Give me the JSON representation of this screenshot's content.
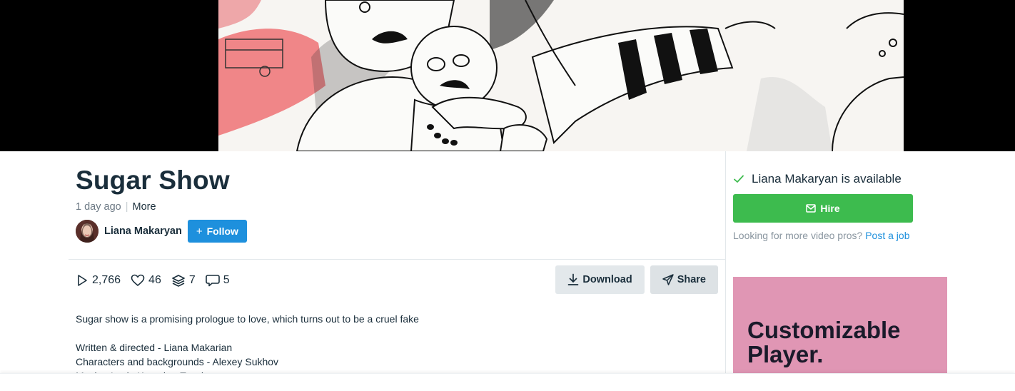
{
  "video": {
    "description_icon": "animation-still"
  },
  "clip": {
    "title": "Sugar Show",
    "age": "1 day ago",
    "more_label": "More"
  },
  "owner": {
    "name": "Liana Makaryan",
    "follow_label": "Follow"
  },
  "stats": {
    "plays": "2,766",
    "likes": "46",
    "collections": "7",
    "comments": "5"
  },
  "actions": {
    "download_label": "Download",
    "share_label": "Share"
  },
  "description": {
    "summary": "Sugar show is a promising prologue to love, which turns out to be a cruel fake",
    "credits": [
      "Written & directed - Liana Makarian",
      "Characters and backgrounds - Alexey Sukhov",
      "Music - Lusia Kazarian-Topchyan"
    ]
  },
  "sidebar": {
    "availability": "Liana Makaryan is available",
    "hire_label": "Hire",
    "looking_text": "Looking for more video pros?",
    "post_job_label": "Post a job",
    "ad_line1": "Customizable",
    "ad_line2": "Player."
  },
  "colors": {
    "brand_blue": "#1e90dd",
    "hire_green": "#3dbb4e",
    "ad_pink": "#e096b4",
    "text_dark": "#1a2e3b"
  }
}
